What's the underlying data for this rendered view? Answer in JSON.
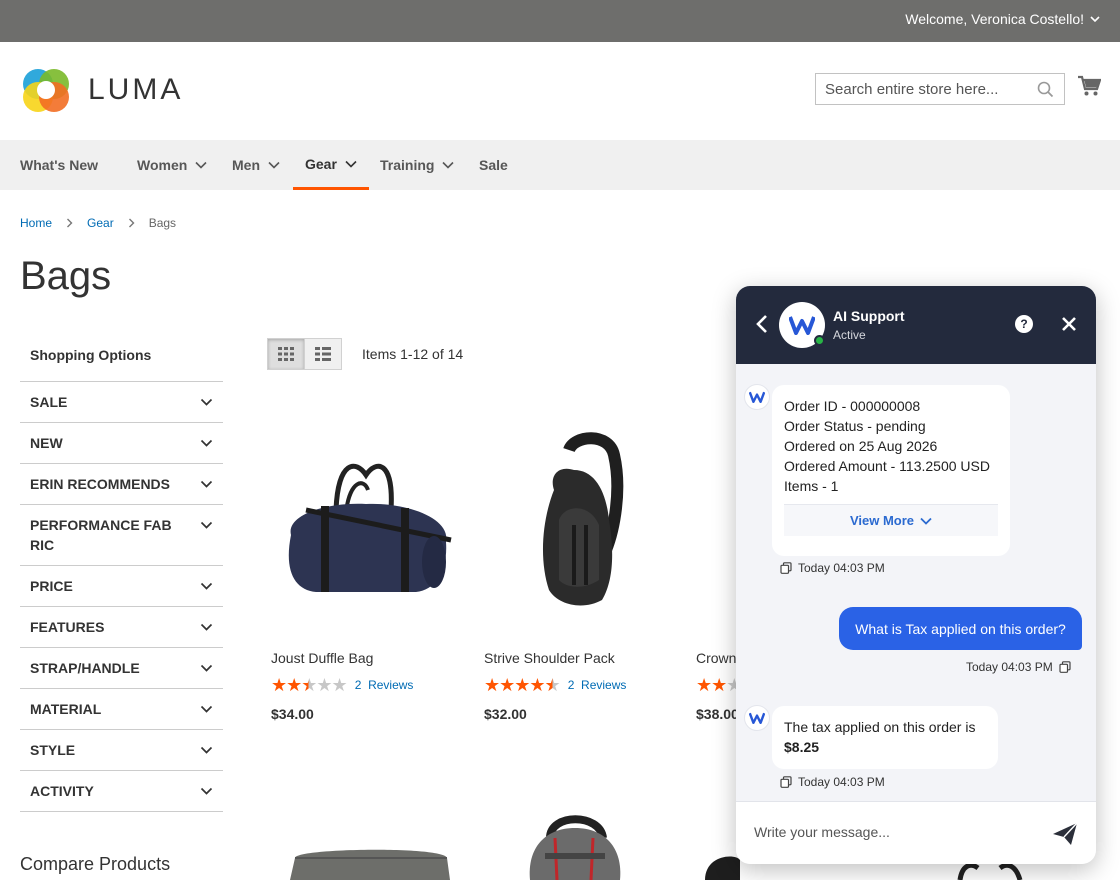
{
  "topbar": {
    "welcome": "Welcome, Veronica Costello!"
  },
  "header": {
    "logo_text": "LUMA",
    "search_placeholder": "Search entire store here..."
  },
  "nav": {
    "items": [
      {
        "label": "What's New"
      },
      {
        "label": "Women"
      },
      {
        "label": "Men"
      },
      {
        "label": "Gear"
      },
      {
        "label": "Training"
      },
      {
        "label": "Sale"
      }
    ]
  },
  "breadcrumbs": {
    "home": "Home",
    "gear": "Gear",
    "current": "Bags"
  },
  "page": {
    "title": "Bags"
  },
  "sidebar": {
    "title": "Shopping Options",
    "filters": [
      "SALE",
      "NEW",
      "ERIN RECOMMENDS",
      "PERFORMANCE FABRIC",
      "PRICE",
      "FEATURES",
      "STRAP/HANDLE",
      "MATERIAL",
      "STYLE",
      "ACTIVITY"
    ],
    "compare_title": "Compare Products"
  },
  "toolbar": {
    "amount": "Items 1-12 of 14"
  },
  "products": [
    {
      "name": "Joust Duffle Bag",
      "rating": 2.5,
      "reviews_count": "2",
      "reviews_label": "Reviews",
      "price": "$34.00"
    },
    {
      "name": "Strive Shoulder Pack",
      "rating": 4.5,
      "reviews_count": "2",
      "reviews_label": "Reviews",
      "price": "$32.00"
    },
    {
      "name": "Crown",
      "rating": 2,
      "price": "$38.00"
    }
  ],
  "chat": {
    "agent_name": "AI Support",
    "agent_status": "Active",
    "help_symbol": "?",
    "order": {
      "line1": "Order ID - 000000008",
      "line2": "Order Status - pending",
      "line3": "Ordered on 25 Aug 2026",
      "line4": "Ordered Amount - 113.2500 USD",
      "line5": "Items - 1",
      "view_more": "View More"
    },
    "ts1": "Today 04:03 PM",
    "user_message": "What is Tax applied on this order?",
    "ts2": "Today 04:03 PM",
    "tax_text": "The tax applied on this order is",
    "tax_amount": "$8.25",
    "ts3": "Today 04:03 PM",
    "input_placeholder": "Write your message..."
  },
  "colors": {
    "accent": "#ff5501",
    "link": "#006bb4",
    "chat_header": "#232a3d",
    "user_bubble": "#2a62e6"
  }
}
